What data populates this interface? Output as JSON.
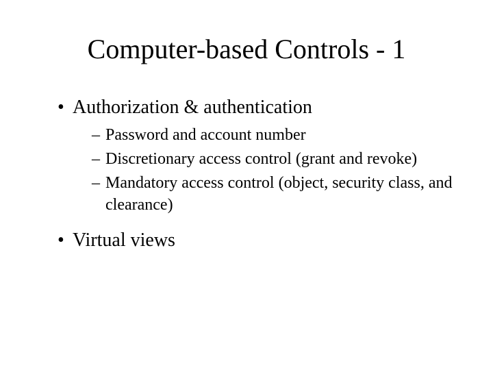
{
  "title": "Computer-based Controls - 1",
  "bullets": [
    {
      "text": "Authorization & authentication",
      "sub": [
        "Password and account number",
        "Discretionary access control (grant and revoke)",
        "Mandatory access control (object, security class, and clearance)"
      ]
    },
    {
      "text": "Virtual views",
      "sub": []
    }
  ]
}
